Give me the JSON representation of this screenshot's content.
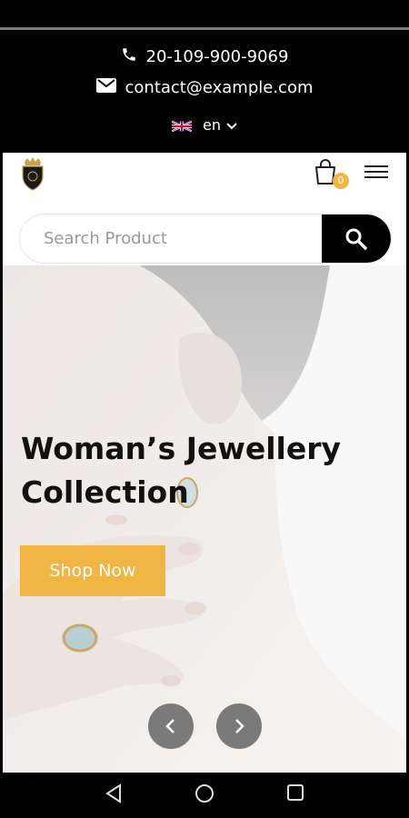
{
  "topbar": {
    "phone": "20-109-900-9069",
    "email": "contact@example.com",
    "language": "en"
  },
  "header": {
    "cart_count": "0"
  },
  "search": {
    "placeholder": "Search Product"
  },
  "hero": {
    "title": "Woman’s Jewellery Collection",
    "cta_label": "Shop Now"
  },
  "icons": {
    "phone": "phone-icon",
    "email": "mail-icon",
    "flag": "uk-flag-icon",
    "language_caret": "chevron-down-icon",
    "logo": "crown-shield-logo",
    "cart": "shopping-bag-icon",
    "menu": "hamburger-menu-icon",
    "search": "search-icon",
    "prev": "chevron-left-icon",
    "next": "chevron-right-icon",
    "nav_back": "triangle-back-icon",
    "nav_home": "circle-home-icon",
    "nav_recents": "square-recents-icon"
  },
  "colors": {
    "accent": "#f0b542",
    "topbar_bg": "#000000",
    "search_button_bg": "#000000",
    "arrow_bg": "#7a7a7a"
  }
}
